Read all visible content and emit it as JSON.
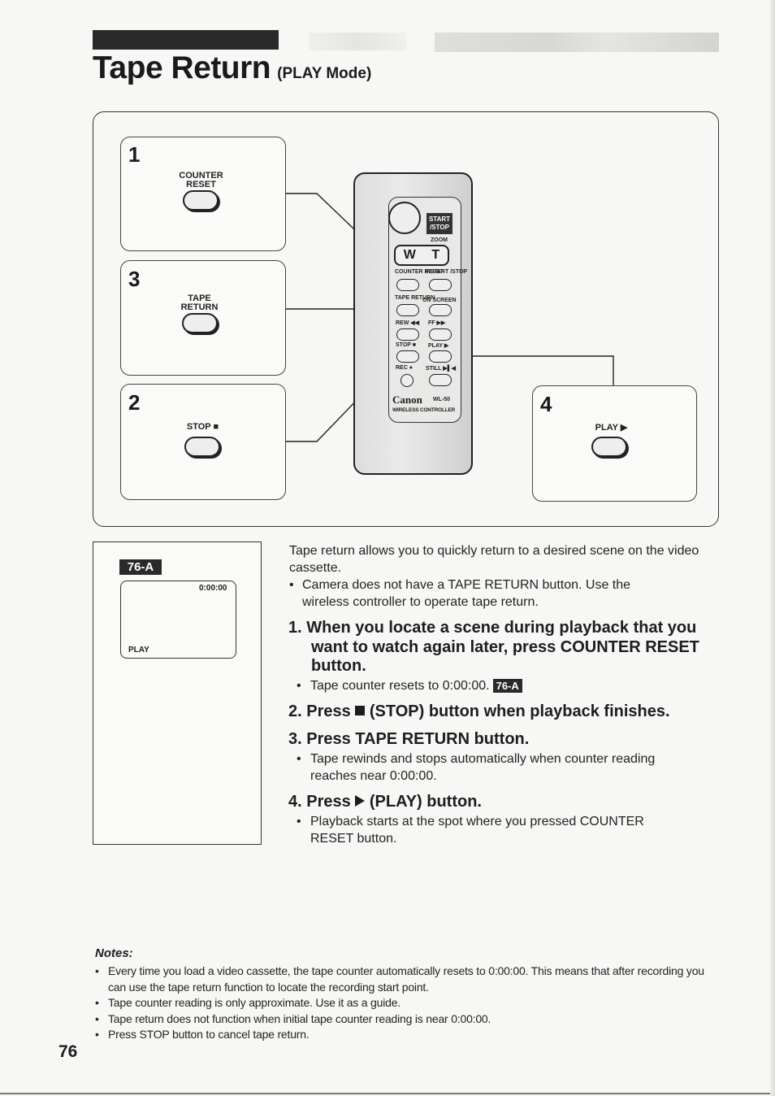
{
  "page": {
    "title": "Tape Return",
    "subtitle": "(PLAY Mode)",
    "page_number": "76"
  },
  "illustration": {
    "steps": [
      {
        "number": "1",
        "button_label_line1": "COUNTER",
        "button_label_line2": "RESET"
      },
      {
        "number": "3",
        "button_label_line1": "TAPE",
        "button_label_line2": "RETURN"
      },
      {
        "number": "2",
        "button_label_line1": "STOP ■",
        "button_label_line2": ""
      },
      {
        "number": "4",
        "button_label_line1": "PLAY ▶",
        "button_label_line2": ""
      }
    ],
    "remote": {
      "start_stop": "START /STOP",
      "zoom": "ZOOM",
      "zoom_w": "W",
      "zoom_t": "T",
      "buttons": [
        {
          "label": "COUNTER RESET"
        },
        {
          "label": "F.START /STOP"
        },
        {
          "label": "TAPE RETURN"
        },
        {
          "label": "ON SCREEN"
        },
        {
          "label": "REW ◀◀"
        },
        {
          "label": "FF ▶▶"
        },
        {
          "label": "STOP ■"
        },
        {
          "label": "PLAY ▶"
        },
        {
          "label": "REC ●"
        },
        {
          "label": "STILL ▶▌◀"
        }
      ],
      "brand": "Canon",
      "model": "WL-50",
      "product": "WIRELESS CONTROLLER"
    }
  },
  "display_panel": {
    "badge": "76-A",
    "counter": "0:00:00",
    "mode": "PLAY"
  },
  "content": {
    "intro": "Tape return allows you to quickly return to a desired scene on the video cassette.",
    "intro_bullet": "Camera does not have a TAPE RETURN button.  Use the wireless controller to operate tape return.",
    "steps": [
      {
        "heading": "1. When you locate a scene during playback that you want to watch again later, press COUNTER RESET button.",
        "bullet": "Tape counter resets to 0:00:00.",
        "badge": "76-A"
      },
      {
        "heading_prefix": "2. Press",
        "heading_suffix": "(STOP) button when playback finishes.",
        "icon": "stop-square"
      },
      {
        "heading": "3. Press TAPE RETURN button.",
        "bullet": "Tape rewinds and stops automatically when counter reading reaches near 0:00:00."
      },
      {
        "heading_prefix": "4. Press",
        "heading_suffix": "(PLAY) button.",
        "icon": "play-triangle",
        "bullet": "Playback starts at the spot where you pressed COUNTER RESET button."
      }
    ]
  },
  "notes": {
    "title": "Notes:",
    "items": [
      "Every time you load a video cassette, the tape counter automatically resets to 0:00:00.  This means that after recording you can use the tape return function to locate the recording start point.",
      "Tape counter reading is only approximate.  Use it as a guide.",
      "Tape return does not function when initial tape counter reading is near 0:00:00.",
      "Press STOP button to cancel tape return."
    ]
  }
}
